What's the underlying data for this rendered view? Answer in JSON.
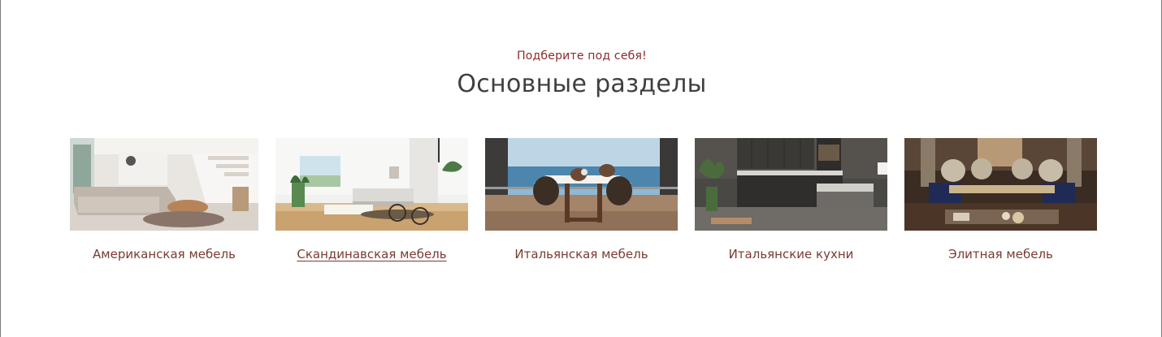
{
  "section": {
    "subtitle": "Подберите под себя!",
    "title": "Основные разделы"
  },
  "categories": [
    {
      "label": "Американская мебель",
      "image": "american-furniture-living-room-photo"
    },
    {
      "label": "Скандинавская мебель",
      "image": "scandinavian-furniture-living-room-photo",
      "active": true
    },
    {
      "label": "Итальянская мебель",
      "image": "italian-furniture-dining-room-photo"
    },
    {
      "label": "Итальянские кухни",
      "image": "italian-kitchen-photo"
    },
    {
      "label": "Элитная мебель",
      "image": "elite-furniture-dining-photo"
    }
  ],
  "colors": {
    "accent": "#8a2a2a",
    "label": "#7a3b32",
    "title": "#3f3f3f"
  }
}
